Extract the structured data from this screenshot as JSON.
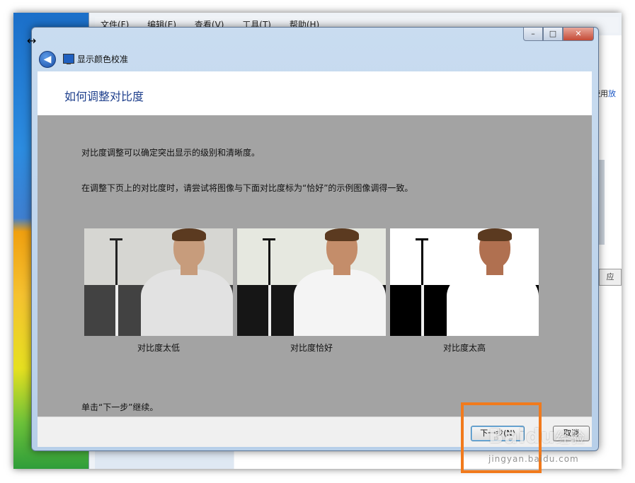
{
  "background_window": {
    "menu": [
      "文件(F)",
      "编辑(E)",
      "查看(V)",
      "工具(T)",
      "帮助(H)"
    ],
    "use_text": "使用",
    "use_link": "放",
    "apply_button": "应"
  },
  "dialog": {
    "app_title": "显示颜色校准",
    "header_title": "如何调整对比度",
    "paragraph1": "对比度调整可以确定突出显示的级别和清晰度。",
    "paragraph2": "在调整下页上的对比度时，请尝试将图像与下面对比度标为“恰好”的示例图像调得一致。",
    "samples": [
      {
        "caption": "对比度太低",
        "sky": "#d6d6d2",
        "ground": "#424242",
        "pole": "#222222",
        "face": "#c79c7c",
        "shirt": "#e2e2e2"
      },
      {
        "caption": "对比度恰好",
        "sky": "#e6e8e0",
        "ground": "#161616",
        "pole": "#111111",
        "face": "#c48d6a",
        "shirt": "#f4f4f4"
      },
      {
        "caption": "对比度太高",
        "sky": "#ffffff",
        "ground": "#000000",
        "pole": "#000000",
        "face": "#b07050",
        "shirt": "#ffffff"
      }
    ],
    "instruction": "单击“下一步”继续。",
    "next_button": "下一步(N)",
    "cancel_button": "取消"
  },
  "window_buttons": {
    "minimize": "–",
    "maximize": "□",
    "close": "✕"
  },
  "watermark": {
    "logo": "Baidu",
    "suffix": "经验",
    "url": "jingyan.baidu.com"
  },
  "colors": {
    "highlight": "#f17a1c",
    "header_title": "#1e3f8c",
    "body_bg": "#a3a3a3"
  }
}
